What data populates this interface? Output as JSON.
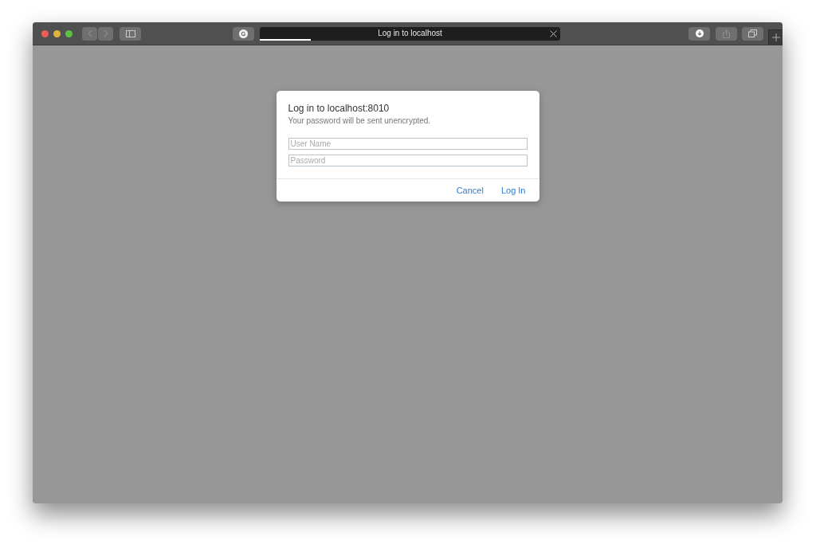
{
  "window": {
    "title": "Log in to localhost",
    "loading": {
      "level": 0.17
    }
  },
  "dialog": {
    "title": "Log in to localhost:8010",
    "message": "Your password will be sent unencrypted.",
    "fields": [
      {
        "placeholder": "User Name"
      },
      {
        "placeholder": "Password"
      }
    ],
    "buttons": [
      "Cancel",
      "Log In"
    ]
  }
}
